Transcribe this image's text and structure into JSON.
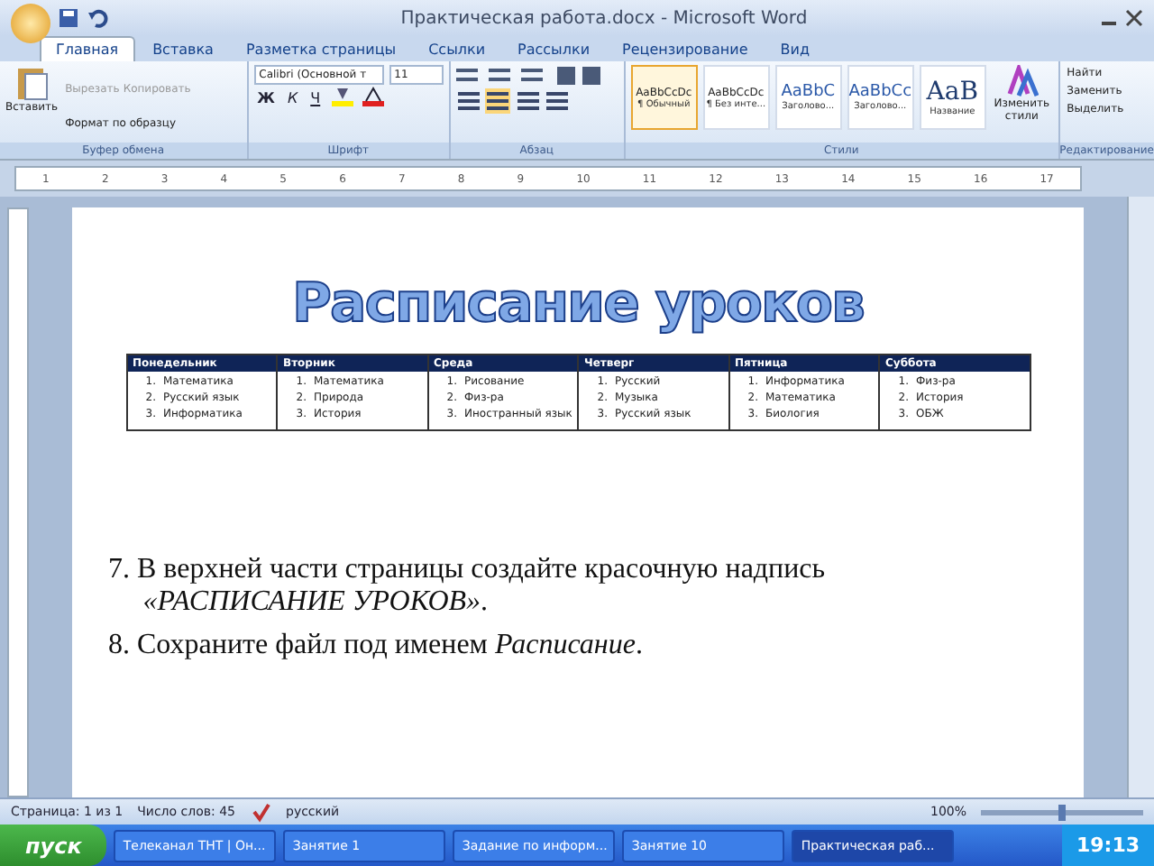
{
  "window": {
    "title": "Практическая работа.docx - Microsoft Word"
  },
  "tabs": [
    {
      "label": "Главная",
      "selected": true
    },
    {
      "label": "Вставка",
      "selected": false
    },
    {
      "label": "Разметка страницы",
      "selected": false
    },
    {
      "label": "Ссылки",
      "selected": false
    },
    {
      "label": "Рассылки",
      "selected": false
    },
    {
      "label": "Рецензирование",
      "selected": false
    },
    {
      "label": "Вид",
      "selected": false
    }
  ],
  "clipboard": {
    "paste": "Вставить",
    "items": [
      {
        "label": "Вырезать",
        "disabled": true
      },
      {
        "label": "Копировать",
        "disabled": true
      },
      {
        "label": "Формат по образцу",
        "disabled": false
      }
    ],
    "group": "Буфер обмена"
  },
  "font": {
    "family": "Calibri (Основной т",
    "size": "11",
    "bold": "Ж",
    "italic": "К",
    "underline": "Ч",
    "group": "Шрифт"
  },
  "paragraph": {
    "group": "Абзац"
  },
  "styles": [
    {
      "sample": "AaBbCcDc",
      "name": "¶ Обычный",
      "selected": true
    },
    {
      "sample": "AaBbCcDc",
      "name": "¶ Без инте...",
      "selected": false
    },
    {
      "sample": "AaBbC",
      "name": "Заголово...",
      "selected": false
    },
    {
      "sample": "AaBbCc",
      "name": "Заголово...",
      "selected": false
    },
    {
      "sample": "AaB",
      "name": "Название",
      "selected": false
    }
  ],
  "change_styles": "Изменить стили",
  "styles_group": "Стили",
  "editing": {
    "items": [
      "Найти",
      "Заменить",
      "Выделить"
    ],
    "group": "Редактирование"
  },
  "ruler": [
    "1",
    "2",
    "3",
    "4",
    "5",
    "6",
    "7",
    "8",
    "9",
    "10",
    "11",
    "12",
    "13",
    "14",
    "15",
    "16",
    "17"
  ],
  "document": {
    "wordart": "Расписание уроков",
    "table": {
      "columns": [
        {
          "day": "Понедельник",
          "items": [
            {
              "n": "1.",
              "t": "Математика"
            },
            {
              "n": "2.",
              "t": "Русский язык"
            },
            {
              "n": "3.",
              "t": "Информатика"
            }
          ]
        },
        {
          "day": "Вторник",
          "items": [
            {
              "n": "1.",
              "t": "Математика"
            },
            {
              "n": "2.",
              "t": "Природа"
            },
            {
              "n": "3.",
              "t": "История"
            }
          ]
        },
        {
          "day": "Среда",
          "items": [
            {
              "n": "1.",
              "t": "Рисование"
            },
            {
              "n": "2.",
              "t": "Физ-ра"
            },
            {
              "n": "3.",
              "t": "Иностранный язык"
            }
          ]
        },
        {
          "day": "Четверг",
          "items": [
            {
              "n": "1.",
              "t": "Русский"
            },
            {
              "n": "2.",
              "t": "Музыка"
            },
            {
              "n": "3.",
              "t": "Русский язык"
            }
          ]
        },
        {
          "day": "Пятница",
          "items": [
            {
              "n": "1.",
              "t": "Информатика"
            },
            {
              "n": "2.",
              "t": "Математика"
            },
            {
              "n": "3.",
              "t": "Биология"
            }
          ]
        },
        {
          "day": "Суббота",
          "items": [
            {
              "n": "1.",
              "t": "Физ-ра"
            },
            {
              "n": "2.",
              "t": "История"
            },
            {
              "n": "3.",
              "t": "ОБЖ"
            }
          ]
        }
      ]
    },
    "instructions": [
      "7. В верхней части страницы создайте красочную надпись *«РАСПИСАНИЕ УРОКОВ»*.",
      "8. Сохраните файл под именем *Расписание*."
    ]
  },
  "status_bar": {
    "page": "Страница: 1 из 1",
    "words": "Число слов: 45",
    "language": "русский",
    "zoom": "100%",
    "zoom_slider": {
      "level": 0.5
    }
  },
  "taskbar": {
    "start": "пуск",
    "items": [
      {
        "label": "Телеканал ТНТ | Он...",
        "selected": false
      },
      {
        "label": "Занятие 1",
        "selected": false
      },
      {
        "label": "Задание по информ...",
        "selected": false
      },
      {
        "label": "Занятие 10",
        "selected": false
      },
      {
        "label": "Практическая раб...",
        "selected": true
      }
    ],
    "clock": "19:13"
  }
}
